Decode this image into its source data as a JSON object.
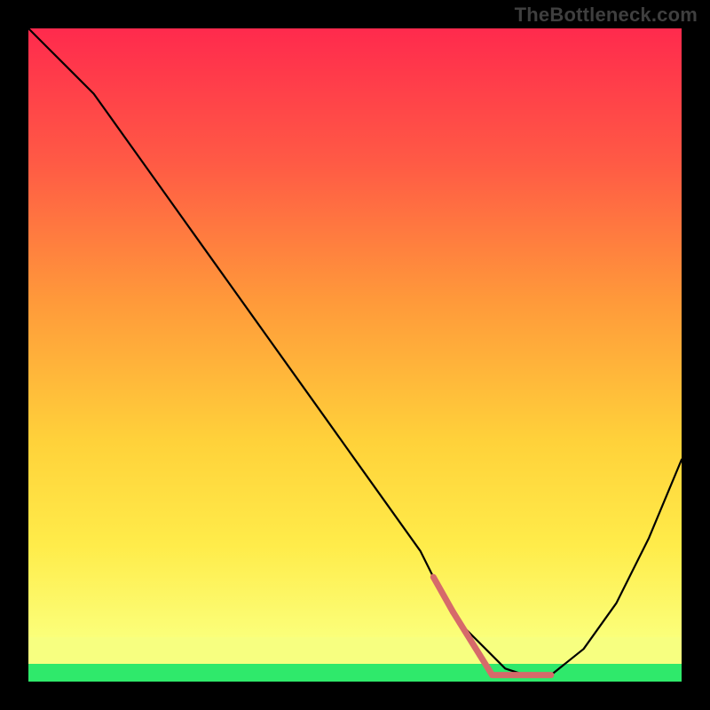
{
  "watermark": "TheBottleneck.com",
  "chart_data": {
    "type": "line",
    "title": "",
    "xlabel": "",
    "ylabel": "",
    "xlim": [
      0,
      100
    ],
    "ylim": [
      0,
      100
    ],
    "grid": false,
    "legend": false,
    "series": [
      {
        "name": "bottleneck-curve",
        "color": "#000000",
        "x": [
          0,
          3,
          6,
          10,
          15,
          20,
          25,
          30,
          35,
          40,
          45,
          50,
          55,
          60,
          62,
          64,
          67,
          70,
          73,
          76,
          80,
          85,
          90,
          95,
          100
        ],
        "y": [
          100,
          97,
          94,
          90,
          83,
          76,
          69,
          62,
          55,
          48,
          41,
          34,
          27,
          20,
          16,
          12,
          8,
          5,
          2,
          1,
          1,
          5,
          12,
          22,
          34
        ]
      }
    ],
    "highlight_segment": {
      "name": "optimal-range",
      "color": "#d66a6a",
      "x_start": 62,
      "x_end": 80
    },
    "background_bands": [
      {
        "y0": 100,
        "y1": 60,
        "type": "gradient",
        "from": "#ff2a4d",
        "to": "#ff8a3a"
      },
      {
        "y0": 60,
        "y1": 25,
        "type": "gradient",
        "from": "#ff8a3a",
        "to": "#ffe23a"
      },
      {
        "y0": 25,
        "y1": 8,
        "type": "gradient",
        "from": "#ffe23a",
        "to": "#fff88a"
      },
      {
        "y0": 8,
        "y1": 2,
        "color": "#f7ff80"
      },
      {
        "y0": 2,
        "y1": 0,
        "color": "#2fe96b"
      }
    ]
  },
  "colors": {
    "frame": "#000000",
    "watermark": "#3f3f3f",
    "highlight": "#d66a6a",
    "green_band": "#2fe96b",
    "pale_band": "#f7ff80"
  }
}
